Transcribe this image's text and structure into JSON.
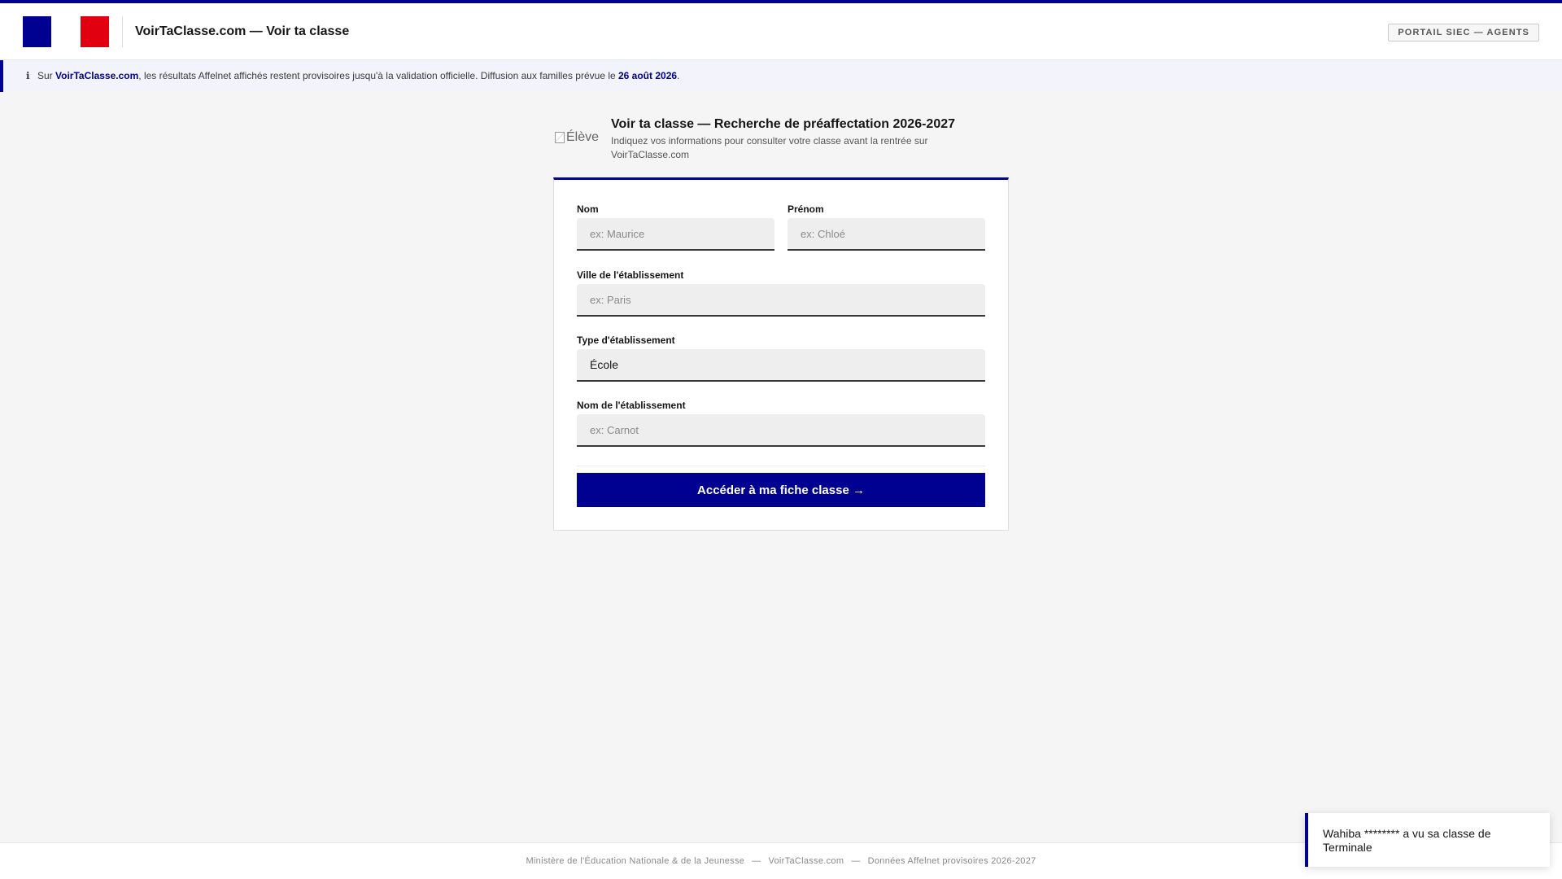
{
  "header": {
    "title": "VoirTaClasse.com — Voir ta classe",
    "portal_button": "PORTAIL SIEC — AGENTS"
  },
  "notice": {
    "icon": "info-icon",
    "icon_glyph": "ℹ",
    "prefix": "Sur ",
    "site": "VoirTaClasse.com",
    "middle": ", les résultats Affelnet affichés restent provisoires jusqu'à la validation officielle. Diffusion aux familles prévue le ",
    "date": "26 août 2026",
    "suffix": "."
  },
  "card": {
    "avatar_alt": "Élève",
    "title": "Voir ta classe — Recherche de préaffectation 2026-2027",
    "subtitle": "Indiquez vos informations pour consulter votre classe avant la rentrée sur VoirTaClasse.com"
  },
  "form": {
    "nom": {
      "label": "Nom",
      "placeholder": "ex: Maurice",
      "value": ""
    },
    "prenom": {
      "label": "Prénom",
      "placeholder": "ex: Chloé",
      "value": ""
    },
    "ville": {
      "label": "Ville de l'établissement",
      "placeholder": "ex: Paris",
      "value": ""
    },
    "type": {
      "label": "Type d'établissement",
      "selected": "École"
    },
    "etablissement": {
      "label": "Nom de l'établissement",
      "placeholder": "ex: Carnot",
      "value": ""
    },
    "submit_label": "Accéder à ma fiche classe →"
  },
  "footer": {
    "ministry": "Ministère de l'Éducation Nationale & de la Jeunesse",
    "site": "VoirTaClasse.com",
    "data": "Données Affelnet provisoires 2026-2027",
    "separator": "—"
  },
  "toast": {
    "message": "Wahiba ******** a vu sa classe de Terminale"
  },
  "colors": {
    "accent": "#000091",
    "flag_blue": "#000091",
    "flag_red": "#e1000f"
  }
}
